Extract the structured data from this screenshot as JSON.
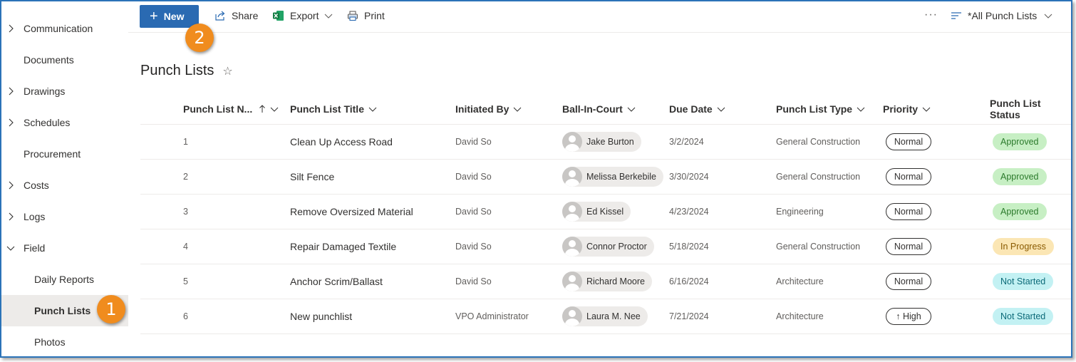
{
  "sidebar": {
    "items": [
      {
        "label": "Communication",
        "chevron": "right"
      },
      {
        "label": "Documents",
        "chevron": ""
      },
      {
        "label": "Drawings",
        "chevron": "right"
      },
      {
        "label": "Schedules",
        "chevron": "right"
      },
      {
        "label": "Procurement",
        "chevron": ""
      },
      {
        "label": "Costs",
        "chevron": "right"
      },
      {
        "label": "Logs",
        "chevron": "right"
      },
      {
        "label": "Field",
        "chevron": "down"
      },
      {
        "label": "Daily Reports",
        "chevron": ""
      },
      {
        "label": "Punch Lists",
        "chevron": ""
      },
      {
        "label": "Photos",
        "chevron": ""
      }
    ]
  },
  "callouts": {
    "one": "1",
    "two": "2"
  },
  "toolbar": {
    "new_label": "New",
    "share_label": "Share",
    "export_label": "Export",
    "print_label": "Print",
    "more_label": "···",
    "view_label": "*All Punch Lists"
  },
  "page": {
    "title": "Punch Lists",
    "star_icon": "☆"
  },
  "columns": {
    "number": "Punch List N...",
    "title": "Punch List Title",
    "initiated": "Initiated By",
    "ball": "Ball-In-Court",
    "due": "Due Date",
    "type": "Punch List Type",
    "priority": "Priority",
    "status": "Punch List Status"
  },
  "rows": [
    {
      "number": "1",
      "title": "Clean Up Access Road",
      "initiated": "David So",
      "ball": "Jake Burton",
      "due": "3/2/2024",
      "type": "General Construction",
      "priority": "Normal",
      "status": "Approved"
    },
    {
      "number": "2",
      "title": "Silt Fence",
      "initiated": "David So",
      "ball": "Melissa Berkebile",
      "due": "3/30/2024",
      "type": "General Construction",
      "priority": "Normal",
      "status": "Approved"
    },
    {
      "number": "3",
      "title": "Remove Oversized Material",
      "initiated": "David So",
      "ball": "Ed Kissel",
      "due": "4/23/2024",
      "type": "Engineering",
      "priority": "Normal",
      "status": "Approved"
    },
    {
      "number": "4",
      "title": "Repair Damaged Textile",
      "initiated": "David So",
      "ball": "Connor Proctor",
      "due": "5/18/2024",
      "type": "General Construction",
      "priority": "Normal",
      "status": "In Progress"
    },
    {
      "number": "5",
      "title": "Anchor Scrim/Ballast",
      "initiated": "David So",
      "ball": "Richard Moore",
      "due": "6/16/2024",
      "type": "Architecture",
      "priority": "Normal",
      "status": "Not Started"
    },
    {
      "number": "6",
      "title": "New punchlist",
      "initiated": "VPO Administrator",
      "ball": "Laura M. Nee",
      "due": "7/21/2024",
      "type": "Architecture",
      "priority": "↑ High",
      "status": "Not Started"
    }
  ],
  "colors": {
    "accent": "#2a6ab2",
    "callout": "#f08c1e",
    "approved_bg": "#c7efc4",
    "approved_fg": "#2b7a2b",
    "inprogress_bg": "#fbe6b4",
    "inprogress_fg": "#8a5a00",
    "notstarted_bg": "#c3f1f3",
    "notstarted_fg": "#0b6a78"
  }
}
